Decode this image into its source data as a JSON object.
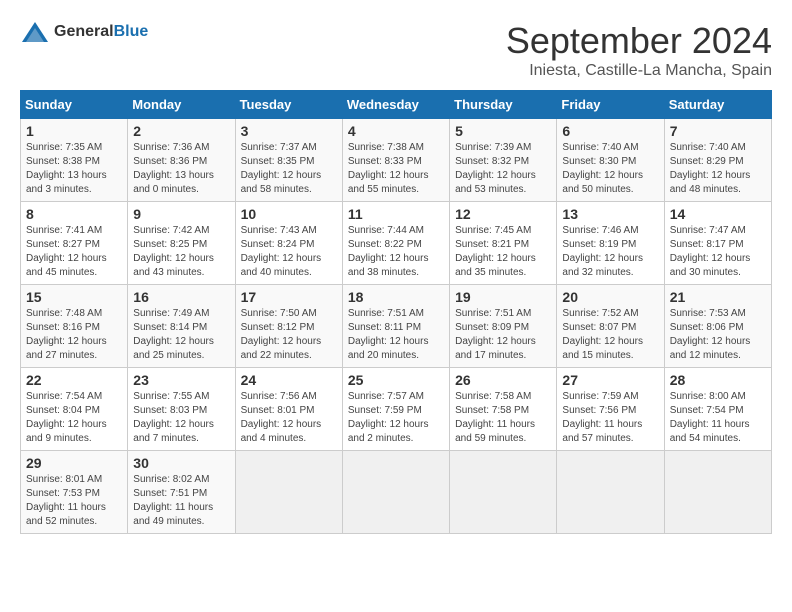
{
  "header": {
    "logo_general": "General",
    "logo_blue": "Blue",
    "month_title": "September 2024",
    "location": "Iniesta, Castille-La Mancha, Spain"
  },
  "calendar": {
    "days_of_week": [
      "Sunday",
      "Monday",
      "Tuesday",
      "Wednesday",
      "Thursday",
      "Friday",
      "Saturday"
    ],
    "weeks": [
      [
        {
          "day": "",
          "sunrise": "",
          "sunset": "",
          "daylight": "",
          "empty": true
        },
        {
          "day": "2",
          "sunrise": "Sunrise: 7:36 AM",
          "sunset": "Sunset: 8:36 PM",
          "daylight": "Daylight: 13 hours and 0 minutes.",
          "empty": false
        },
        {
          "day": "3",
          "sunrise": "Sunrise: 7:37 AM",
          "sunset": "Sunset: 8:35 PM",
          "daylight": "Daylight: 12 hours and 58 minutes.",
          "empty": false
        },
        {
          "day": "4",
          "sunrise": "Sunrise: 7:38 AM",
          "sunset": "Sunset: 8:33 PM",
          "daylight": "Daylight: 12 hours and 55 minutes.",
          "empty": false
        },
        {
          "day": "5",
          "sunrise": "Sunrise: 7:39 AM",
          "sunset": "Sunset: 8:32 PM",
          "daylight": "Daylight: 12 hours and 53 minutes.",
          "empty": false
        },
        {
          "day": "6",
          "sunrise": "Sunrise: 7:40 AM",
          "sunset": "Sunset: 8:30 PM",
          "daylight": "Daylight: 12 hours and 50 minutes.",
          "empty": false
        },
        {
          "day": "7",
          "sunrise": "Sunrise: 7:40 AM",
          "sunset": "Sunset: 8:29 PM",
          "daylight": "Daylight: 12 hours and 48 minutes.",
          "empty": false
        }
      ],
      [
        {
          "day": "8",
          "sunrise": "Sunrise: 7:41 AM",
          "sunset": "Sunset: 8:27 PM",
          "daylight": "Daylight: 12 hours and 45 minutes.",
          "empty": false
        },
        {
          "day": "9",
          "sunrise": "Sunrise: 7:42 AM",
          "sunset": "Sunset: 8:25 PM",
          "daylight": "Daylight: 12 hours and 43 minutes.",
          "empty": false
        },
        {
          "day": "10",
          "sunrise": "Sunrise: 7:43 AM",
          "sunset": "Sunset: 8:24 PM",
          "daylight": "Daylight: 12 hours and 40 minutes.",
          "empty": false
        },
        {
          "day": "11",
          "sunrise": "Sunrise: 7:44 AM",
          "sunset": "Sunset: 8:22 PM",
          "daylight": "Daylight: 12 hours and 38 minutes.",
          "empty": false
        },
        {
          "day": "12",
          "sunrise": "Sunrise: 7:45 AM",
          "sunset": "Sunset: 8:21 PM",
          "daylight": "Daylight: 12 hours and 35 minutes.",
          "empty": false
        },
        {
          "day": "13",
          "sunrise": "Sunrise: 7:46 AM",
          "sunset": "Sunset: 8:19 PM",
          "daylight": "Daylight: 12 hours and 32 minutes.",
          "empty": false
        },
        {
          "day": "14",
          "sunrise": "Sunrise: 7:47 AM",
          "sunset": "Sunset: 8:17 PM",
          "daylight": "Daylight: 12 hours and 30 minutes.",
          "empty": false
        }
      ],
      [
        {
          "day": "15",
          "sunrise": "Sunrise: 7:48 AM",
          "sunset": "Sunset: 8:16 PM",
          "daylight": "Daylight: 12 hours and 27 minutes.",
          "empty": false
        },
        {
          "day": "16",
          "sunrise": "Sunrise: 7:49 AM",
          "sunset": "Sunset: 8:14 PM",
          "daylight": "Daylight: 12 hours and 25 minutes.",
          "empty": false
        },
        {
          "day": "17",
          "sunrise": "Sunrise: 7:50 AM",
          "sunset": "Sunset: 8:12 PM",
          "daylight": "Daylight: 12 hours and 22 minutes.",
          "empty": false
        },
        {
          "day": "18",
          "sunrise": "Sunrise: 7:51 AM",
          "sunset": "Sunset: 8:11 PM",
          "daylight": "Daylight: 12 hours and 20 minutes.",
          "empty": false
        },
        {
          "day": "19",
          "sunrise": "Sunrise: 7:51 AM",
          "sunset": "Sunset: 8:09 PM",
          "daylight": "Daylight: 12 hours and 17 minutes.",
          "empty": false
        },
        {
          "day": "20",
          "sunrise": "Sunrise: 7:52 AM",
          "sunset": "Sunset: 8:07 PM",
          "daylight": "Daylight: 12 hours and 15 minutes.",
          "empty": false
        },
        {
          "day": "21",
          "sunrise": "Sunrise: 7:53 AM",
          "sunset": "Sunset: 8:06 PM",
          "daylight": "Daylight: 12 hours and 12 minutes.",
          "empty": false
        }
      ],
      [
        {
          "day": "22",
          "sunrise": "Sunrise: 7:54 AM",
          "sunset": "Sunset: 8:04 PM",
          "daylight": "Daylight: 12 hours and 9 minutes.",
          "empty": false
        },
        {
          "day": "23",
          "sunrise": "Sunrise: 7:55 AM",
          "sunset": "Sunset: 8:03 PM",
          "daylight": "Daylight: 12 hours and 7 minutes.",
          "empty": false
        },
        {
          "day": "24",
          "sunrise": "Sunrise: 7:56 AM",
          "sunset": "Sunset: 8:01 PM",
          "daylight": "Daylight: 12 hours and 4 minutes.",
          "empty": false
        },
        {
          "day": "25",
          "sunrise": "Sunrise: 7:57 AM",
          "sunset": "Sunset: 7:59 PM",
          "daylight": "Daylight: 12 hours and 2 minutes.",
          "empty": false
        },
        {
          "day": "26",
          "sunrise": "Sunrise: 7:58 AM",
          "sunset": "Sunset: 7:58 PM",
          "daylight": "Daylight: 11 hours and 59 minutes.",
          "empty": false
        },
        {
          "day": "27",
          "sunrise": "Sunrise: 7:59 AM",
          "sunset": "Sunset: 7:56 PM",
          "daylight": "Daylight: 11 hours and 57 minutes.",
          "empty": false
        },
        {
          "day": "28",
          "sunrise": "Sunrise: 8:00 AM",
          "sunset": "Sunset: 7:54 PM",
          "daylight": "Daylight: 11 hours and 54 minutes.",
          "empty": false
        }
      ],
      [
        {
          "day": "29",
          "sunrise": "Sunrise: 8:01 AM",
          "sunset": "Sunset: 7:53 PM",
          "daylight": "Daylight: 11 hours and 52 minutes.",
          "empty": false
        },
        {
          "day": "30",
          "sunrise": "Sunrise: 8:02 AM",
          "sunset": "Sunset: 7:51 PM",
          "daylight": "Daylight: 11 hours and 49 minutes.",
          "empty": false
        },
        {
          "day": "",
          "sunrise": "",
          "sunset": "",
          "daylight": "",
          "empty": true
        },
        {
          "day": "",
          "sunrise": "",
          "sunset": "",
          "daylight": "",
          "empty": true
        },
        {
          "day": "",
          "sunrise": "",
          "sunset": "",
          "daylight": "",
          "empty": true
        },
        {
          "day": "",
          "sunrise": "",
          "sunset": "",
          "daylight": "",
          "empty": true
        },
        {
          "day": "",
          "sunrise": "",
          "sunset": "",
          "daylight": "",
          "empty": true
        }
      ]
    ],
    "first_row": [
      {
        "day": "1",
        "sunrise": "Sunrise: 7:35 AM",
        "sunset": "Sunset: 8:38 PM",
        "daylight": "Daylight: 13 hours and 3 minutes.",
        "empty": false
      },
      {
        "day": "2",
        "sunrise": "Sunrise: 7:36 AM",
        "sunset": "Sunset: 8:36 PM",
        "daylight": "Daylight: 13 hours and 0 minutes.",
        "empty": false
      },
      {
        "day": "3",
        "sunrise": "Sunrise: 7:37 AM",
        "sunset": "Sunset: 8:35 PM",
        "daylight": "Daylight: 12 hours and 58 minutes.",
        "empty": false
      },
      {
        "day": "4",
        "sunrise": "Sunrise: 7:38 AM",
        "sunset": "Sunset: 8:33 PM",
        "daylight": "Daylight: 12 hours and 55 minutes.",
        "empty": false
      },
      {
        "day": "5",
        "sunrise": "Sunrise: 7:39 AM",
        "sunset": "Sunset: 8:32 PM",
        "daylight": "Daylight: 12 hours and 53 minutes.",
        "empty": false
      },
      {
        "day": "6",
        "sunrise": "Sunrise: 7:40 AM",
        "sunset": "Sunset: 8:30 PM",
        "daylight": "Daylight: 12 hours and 50 minutes.",
        "empty": false
      },
      {
        "day": "7",
        "sunrise": "Sunrise: 7:40 AM",
        "sunset": "Sunset: 8:29 PM",
        "daylight": "Daylight: 12 hours and 48 minutes.",
        "empty": false
      }
    ]
  }
}
